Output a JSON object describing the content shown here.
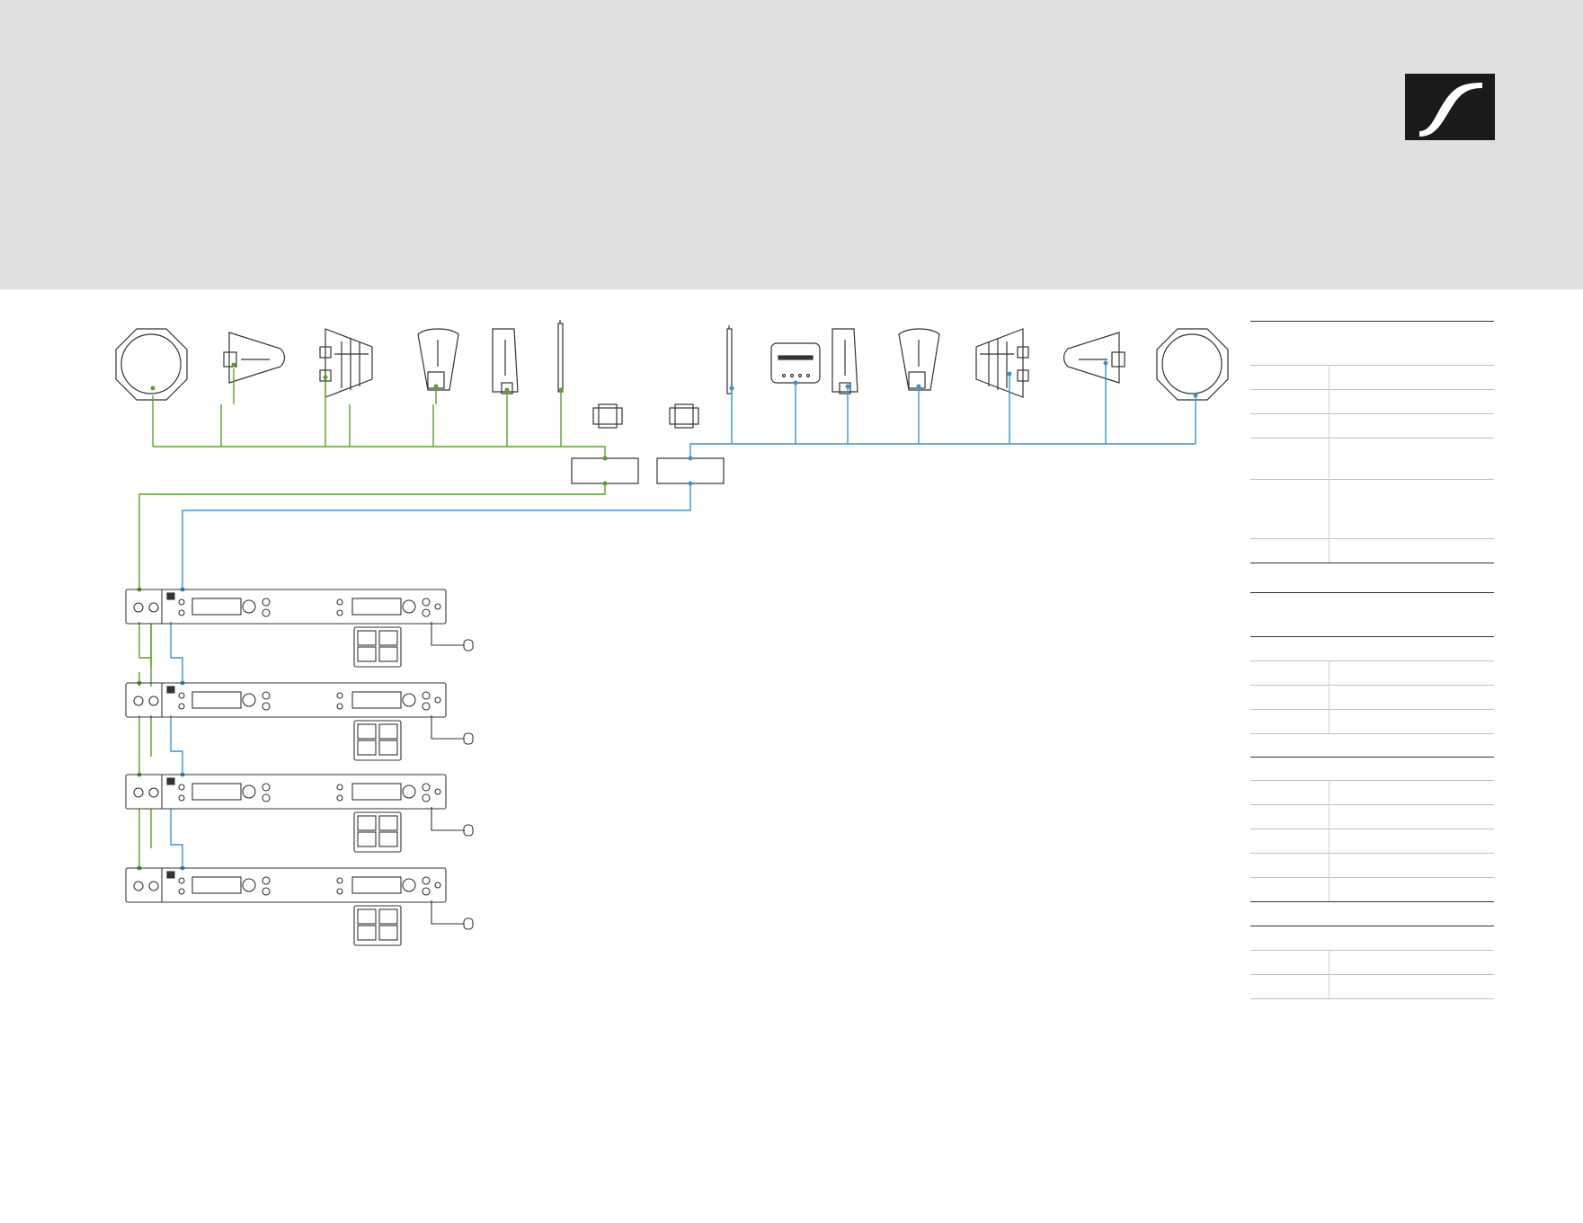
{
  "brand": {
    "logo_icon": "sennheiser-logo-icon",
    "logo_bg": "#1a1a1a"
  },
  "colors": {
    "green_line": "#5aa02c",
    "blue_line": "#3a93d3",
    "stroke": "#333333",
    "band": "#dfe0df"
  },
  "diagram": {
    "antennas_green": [
      "dome-antenna-icon",
      "paddle-antenna-icon",
      "log-periodic-antenna-icon",
      "wedge-antenna-icon",
      "slim-antenna-icon",
      "rod-antenna-icon"
    ],
    "antennas_blue": [
      "rod-antenna-icon",
      "square-antenna-icon",
      "slim-antenna-icon",
      "wedge-antenna-icon",
      "log-periodic-antenna-icon",
      "paddle-antenna-icon",
      "dome-antenna-icon"
    ],
    "boosters": [
      "booster-icon",
      "booster-icon"
    ],
    "splitters": [
      "splitter-box-a",
      "splitter-box-b"
    ],
    "receivers": [
      "receiver-unit-1",
      "receiver-unit-2",
      "receiver-unit-3",
      "receiver-unit-4"
    ]
  }
}
